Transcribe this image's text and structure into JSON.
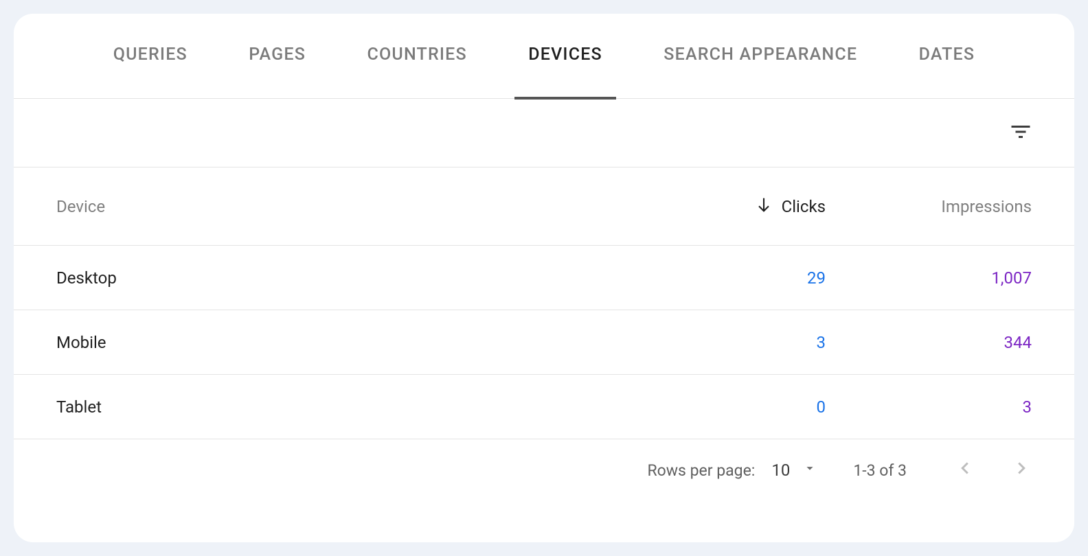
{
  "tabs": [
    {
      "label": "QUERIES",
      "active": false
    },
    {
      "label": "PAGES",
      "active": false
    },
    {
      "label": "COUNTRIES",
      "active": false
    },
    {
      "label": "DEVICES",
      "active": true
    },
    {
      "label": "SEARCH APPEARANCE",
      "active": false
    },
    {
      "label": "DATES",
      "active": false
    }
  ],
  "table": {
    "headers": {
      "device": "Device",
      "clicks": "Clicks",
      "impressions": "Impressions"
    },
    "sort_column": "clicks",
    "sort_direction": "desc",
    "rows": [
      {
        "device": "Desktop",
        "clicks": "29",
        "impressions": "1,007"
      },
      {
        "device": "Mobile",
        "clicks": "3",
        "impressions": "344"
      },
      {
        "device": "Tablet",
        "clicks": "0",
        "impressions": "3"
      }
    ]
  },
  "pagination": {
    "rows_per_page_label": "Rows per page:",
    "rows_per_page_value": "10",
    "range_text": "1-3 of 3"
  },
  "colors": {
    "clicks": "#1a73e8",
    "impressions": "#7c26c4"
  }
}
